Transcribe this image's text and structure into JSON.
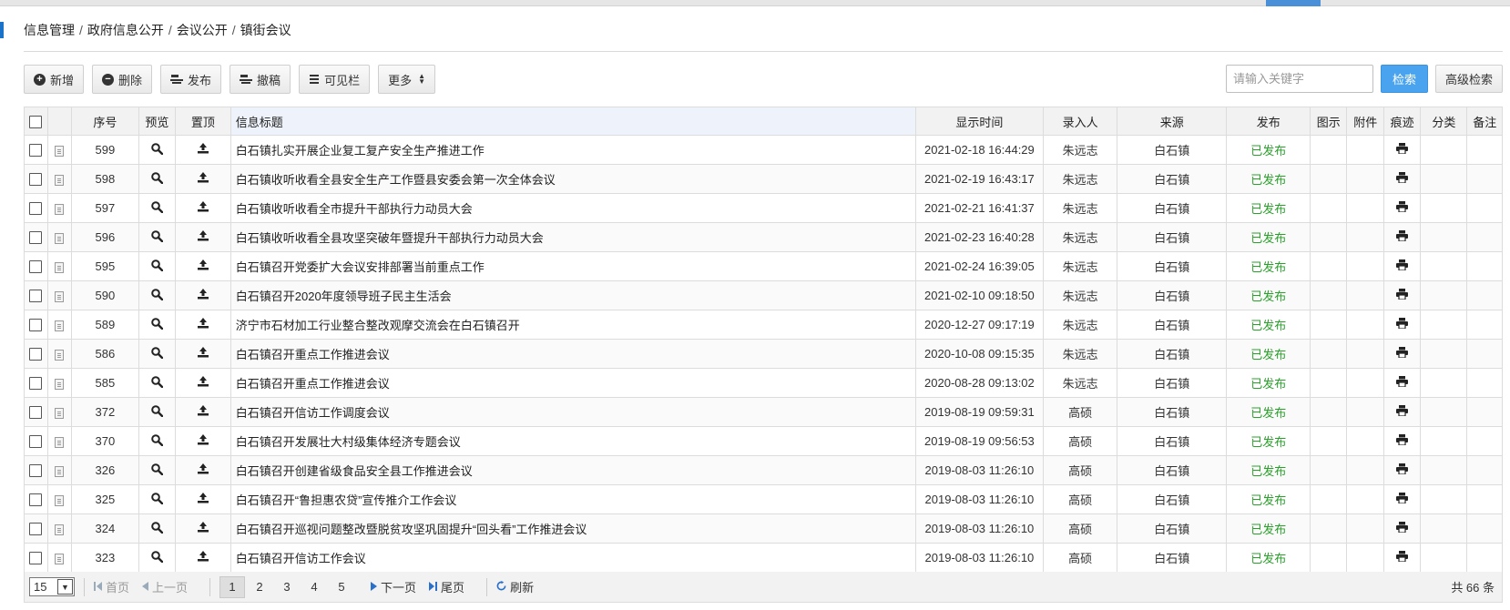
{
  "breadcrumb": [
    "信息管理",
    "政府信息公开",
    "会议公开",
    "镇街会议"
  ],
  "toolbar": {
    "add": "新增",
    "delete": "删除",
    "publish": "发布",
    "withdraw": "撤稿",
    "columns": "可见栏",
    "more": "更多"
  },
  "search": {
    "placeholder": "请输入关键字",
    "search_label": "检索",
    "advanced_label": "高级检索"
  },
  "table": {
    "headers": {
      "seq": "序号",
      "preview": "预览",
      "top": "置顶",
      "title": "信息标题",
      "time": "显示时间",
      "author": "录入人",
      "source": "来源",
      "publish": "发布",
      "image": "图示",
      "attachment": "附件",
      "trace": "痕迹",
      "category": "分类",
      "remark": "备注"
    },
    "rows": [
      {
        "seq": "599",
        "title": "白石镇扎实开展企业复工复产安全生产推进工作",
        "time": "2021-02-18 16:44:29",
        "author": "朱远志",
        "source": "白石镇",
        "status": "已发布"
      },
      {
        "seq": "598",
        "title": "白石镇收听收看全县安全生产工作暨县安委会第一次全体会议",
        "time": "2021-02-19 16:43:17",
        "author": "朱远志",
        "source": "白石镇",
        "status": "已发布"
      },
      {
        "seq": "597",
        "title": "白石镇收听收看全市提升干部执行力动员大会",
        "time": "2021-02-21 16:41:37",
        "author": "朱远志",
        "source": "白石镇",
        "status": "已发布"
      },
      {
        "seq": "596",
        "title": "白石镇收听收看全县攻坚突破年暨提升干部执行力动员大会",
        "time": "2021-02-23 16:40:28",
        "author": "朱远志",
        "source": "白石镇",
        "status": "已发布"
      },
      {
        "seq": "595",
        "title": "白石镇召开党委扩大会议安排部署当前重点工作",
        "time": "2021-02-24 16:39:05",
        "author": "朱远志",
        "source": "白石镇",
        "status": "已发布"
      },
      {
        "seq": "590",
        "title": "白石镇召开2020年度领导班子民主生活会",
        "time": "2021-02-10 09:18:50",
        "author": "朱远志",
        "source": "白石镇",
        "status": "已发布"
      },
      {
        "seq": "589",
        "title": "济宁市石材加工行业整合整改观摩交流会在白石镇召开",
        "time": "2020-12-27 09:17:19",
        "author": "朱远志",
        "source": "白石镇",
        "status": "已发布"
      },
      {
        "seq": "586",
        "title": "白石镇召开重点工作推进会议",
        "time": "2020-10-08 09:15:35",
        "author": "朱远志",
        "source": "白石镇",
        "status": "已发布"
      },
      {
        "seq": "585",
        "title": "白石镇召开重点工作推进会议",
        "time": "2020-08-28 09:13:02",
        "author": "朱远志",
        "source": "白石镇",
        "status": "已发布"
      },
      {
        "seq": "372",
        "title": "白石镇召开信访工作调度会议",
        "time": "2019-08-19 09:59:31",
        "author": "高硕",
        "source": "白石镇",
        "status": "已发布"
      },
      {
        "seq": "370",
        "title": "白石镇召开发展壮大村级集体经济专题会议",
        "time": "2019-08-19 09:56:53",
        "author": "高硕",
        "source": "白石镇",
        "status": "已发布"
      },
      {
        "seq": "326",
        "title": "白石镇召开创建省级食品安全县工作推进会议",
        "time": "2019-08-03 11:26:10",
        "author": "高硕",
        "source": "白石镇",
        "status": "已发布"
      },
      {
        "seq": "325",
        "title": "白石镇召开“鲁担惠农贷”宣传推介工作会议",
        "time": "2019-08-03 11:26:10",
        "author": "高硕",
        "source": "白石镇",
        "status": "已发布"
      },
      {
        "seq": "324",
        "title": "白石镇召开巡视问题整改暨脱贫攻坚巩固提升“回头看”工作推进会议",
        "time": "2019-08-03 11:26:10",
        "author": "高硕",
        "source": "白石镇",
        "status": "已发布"
      },
      {
        "seq": "323",
        "title": "白石镇召开信访工作会议",
        "time": "2019-08-03 11:26:10",
        "author": "高硕",
        "source": "白石镇",
        "status": "已发布"
      }
    ]
  },
  "pager": {
    "page_size": "15",
    "first": "首页",
    "prev": "上一页",
    "pages": [
      "1",
      "2",
      "3",
      "4",
      "5"
    ],
    "current_page": "1",
    "next": "下一页",
    "last": "尾页",
    "refresh": "刷新",
    "total": "共 66 条"
  },
  "colors": {
    "accent": "#4aa3ee",
    "published": "#2aa02a"
  }
}
